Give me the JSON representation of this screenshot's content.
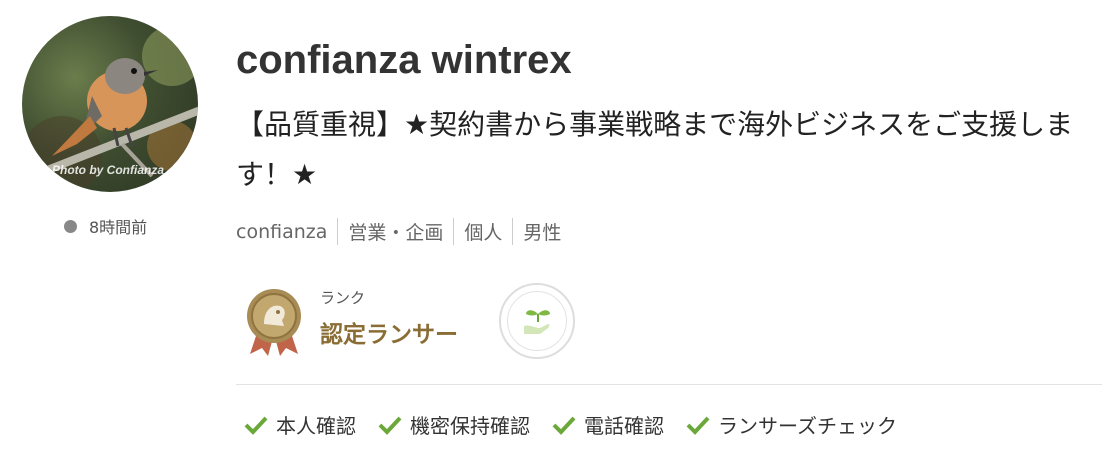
{
  "profile": {
    "avatar_caption": "Photo by Confianza",
    "status_text": "8時間前",
    "name": "confianza wintrex",
    "tagline": "【品質重視】★契約書から事業戦略まで海外ビジネスをご支援します！★",
    "meta": [
      "confianza",
      "営業・企画",
      "個人",
      "男性"
    ]
  },
  "rank": {
    "label": "ランク",
    "value": "認定ランサー",
    "badge_icon": "rank-medal-icon",
    "badge2_icon": "sprout-icon"
  },
  "verifications": [
    {
      "label": "本人確認"
    },
    {
      "label": "機密保持確認"
    },
    {
      "label": "電話確認"
    },
    {
      "label": "ランサーズチェック"
    }
  ],
  "colors": {
    "rank_gold": "#8a6d34",
    "check_green": "#6aa83a",
    "status_dot": "#888888"
  }
}
